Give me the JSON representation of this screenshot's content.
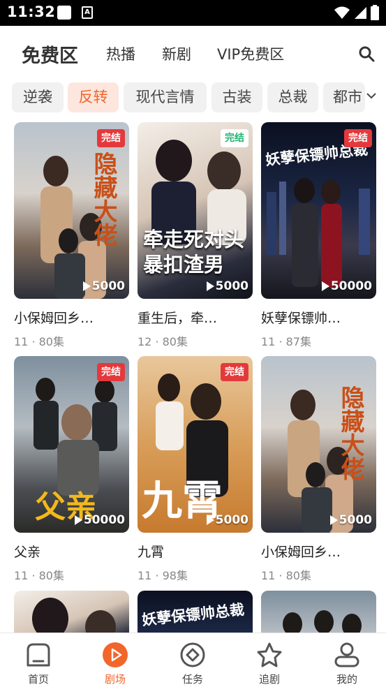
{
  "status": {
    "time": "11:32",
    "sim_glyph": "A"
  },
  "topnav": {
    "tabs": [
      "免费区",
      "热播",
      "新剧",
      "VIP免费区"
    ],
    "active_index": 0,
    "active_color": "#333333"
  },
  "chips": {
    "items": [
      "逆袭",
      "反转",
      "现代言情",
      "古装",
      "总裁",
      "都市"
    ],
    "active_index": 1,
    "active_color": "#f2652b"
  },
  "cards": [
    {
      "title": "小保姆回乡…",
      "meta": "11 · 80集",
      "badge": "完结",
      "plays": "5000",
      "poster_text": "隐藏大佬"
    },
    {
      "title": "重生后，牵…",
      "meta": "12 · 80集",
      "badge": "完结",
      "plays": "5000",
      "poster_text": "牵走死对头暴扣渣男"
    },
    {
      "title": "妖孽保镖帅…",
      "meta": "11 · 87集",
      "badge": "完结",
      "plays": "50000",
      "poster_text": "妖孽保镖帅总裁"
    },
    {
      "title": "父亲",
      "meta": "11 · 80集",
      "badge": "完结",
      "plays": "50000",
      "poster_text": "父亲"
    },
    {
      "title": "九霄",
      "meta": "11 · 98集",
      "badge": "完结",
      "plays": "5000",
      "poster_text": "九霄"
    },
    {
      "title": "小保姆回乡…",
      "meta": "11 · 80集",
      "badge": "",
      "plays": "5000",
      "poster_text": "隐藏大佬"
    }
  ],
  "partial_cards": [
    {
      "poster_text": ""
    },
    {
      "poster_text": "妖孽保镖帅总裁"
    },
    {
      "poster_text": ""
    }
  ],
  "bottomnav": {
    "items": [
      "首页",
      "剧场",
      "任务",
      "追剧",
      "我的"
    ],
    "active_index": 1,
    "active_color": "#f2652b"
  }
}
